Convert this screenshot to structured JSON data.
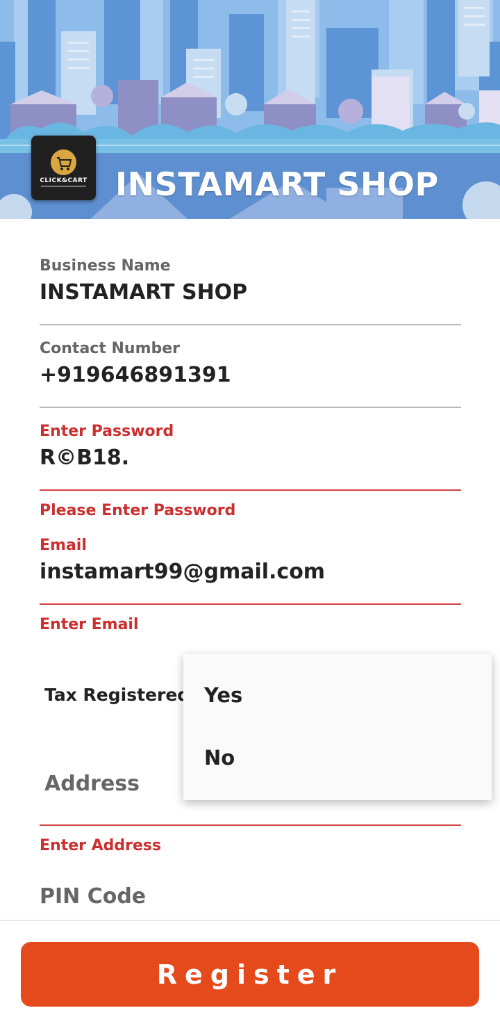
{
  "header": {
    "title": "INSTAMART SHOP",
    "logo_text": "CLICK&CART"
  },
  "form": {
    "business_name": {
      "label": "Business Name",
      "value": "INSTAMART SHOP"
    },
    "contact_number": {
      "label": "Contact Number",
      "value": "+919646891391"
    },
    "password": {
      "label": "Enter Password",
      "value": "R©B18.",
      "error": "Please Enter Password"
    },
    "email": {
      "label": "Email",
      "value": "instamart99@gmail.com",
      "error": "Enter Email"
    },
    "tax_registered": {
      "label": "Tax Registered",
      "options": [
        "Yes",
        "No"
      ]
    },
    "address": {
      "placeholder": "Address",
      "error": "Enter Address"
    },
    "pin_code": {
      "placeholder": "PIN Code"
    }
  },
  "register_button": "Register",
  "colors": {
    "accent": "#e54a1c",
    "error": "#cc2f2f",
    "sky": "#6ba8dd"
  }
}
